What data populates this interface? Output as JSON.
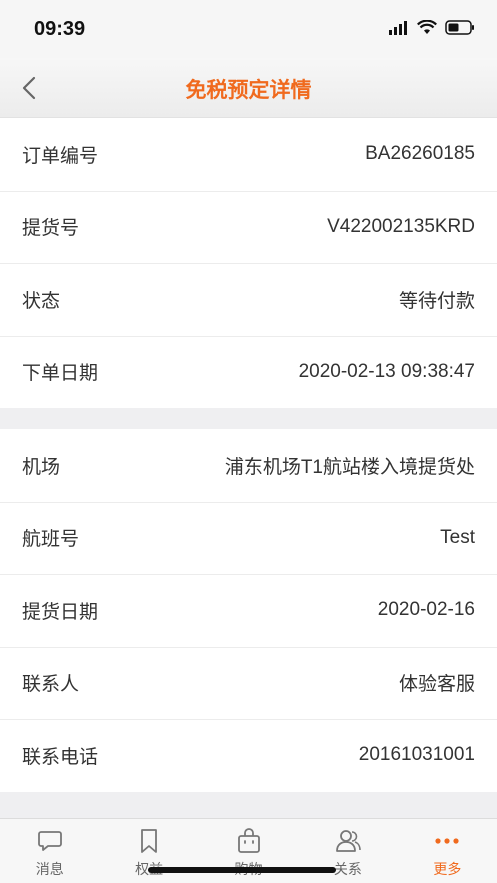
{
  "status_bar": {
    "time": "09:39"
  },
  "nav": {
    "title": "免税预定详情"
  },
  "order_info": [
    {
      "label": "订单编号",
      "value": "BA26260185"
    },
    {
      "label": "提货号",
      "value": "V422002135KRD"
    },
    {
      "label": "状态",
      "value": "等待付款"
    },
    {
      "label": "下单日期",
      "value": "2020-02-13 09:38:47"
    }
  ],
  "pickup_info": [
    {
      "label": "机场",
      "value": "浦东机场T1航站楼入境提货处"
    },
    {
      "label": "航班号",
      "value": "Test"
    },
    {
      "label": "提货日期",
      "value": "2020-02-16"
    },
    {
      "label": "联系人",
      "value": "体验客服"
    },
    {
      "label": "联系电话",
      "value": "20161031001"
    }
  ],
  "tabs": [
    {
      "label": "消息",
      "icon": "message-icon"
    },
    {
      "label": "权益",
      "icon": "bookmark-icon"
    },
    {
      "label": "购物",
      "icon": "shopping-bag-icon"
    },
    {
      "label": "关系",
      "icon": "people-icon"
    },
    {
      "label": "更多",
      "icon": "more-icon",
      "active": true
    }
  ],
  "colors": {
    "accent": "#f06a1e",
    "background": "#efeff1"
  }
}
